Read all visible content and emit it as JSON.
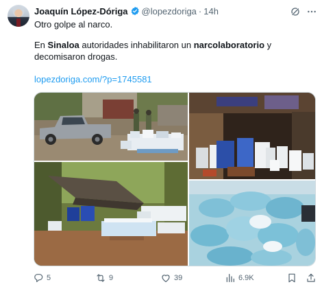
{
  "tweet": {
    "author_name": "Joaquín López-Dóriga",
    "handle": "@lopezdoriga",
    "separator": "·",
    "time": "14h",
    "text_line1": "Otro golpe al narco.",
    "text_p2_a": "En ",
    "text_p2_b": "Sinaloa",
    "text_p2_c": " autoridades inhabilitaron un ",
    "text_p2_d": "narcolaboratorio",
    "text_p2_e": " y decomisaron drogas.",
    "link": "lopezdoriga.com/?p=1745581"
  },
  "actions": {
    "replies": "5",
    "reposts": "9",
    "likes": "39",
    "views": "6.9K"
  },
  "icons": {
    "verified": "verified-badge-icon",
    "grok": "grok-icon",
    "more": "more-icon",
    "reply": "reply-icon",
    "repost": "repost-icon",
    "like": "heart-icon",
    "views": "views-icon",
    "bookmark": "bookmark-icon",
    "share": "share-icon"
  },
  "colors": {
    "link": "#1d9bf0",
    "secondary_text": "#536471",
    "verified": "#1d9bf0"
  }
}
